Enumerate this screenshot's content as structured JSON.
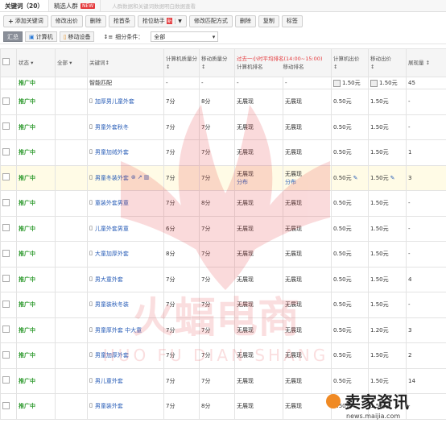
{
  "tabs": {
    "keywords": "关键词（20）",
    "crowd": "精选人群",
    "crowd_badge": "NEW",
    "note": "人群数据和关键词数据明白数据查看"
  },
  "toolbar": {
    "add": "添加关键词",
    "edit_bid": "修改出价",
    "delete_top": "删除",
    "rush": "抢首条",
    "rank": "抢位助手",
    "rank_badge": "新",
    "match": "修改匹配方式",
    "delete": "删除",
    "copy": "复制",
    "tag": "标签"
  },
  "filter": {
    "summary": "汇总",
    "pc": "计算机",
    "mobile": "移动设备",
    "cond_label": "细分条件：",
    "cond_value": "全部"
  },
  "header": {
    "status": "状态",
    "all": "全部",
    "keyword": "关键词",
    "pc_score": "计算机质量分",
    "mobile_score": "移动质量分",
    "hour_red": "过去一小时平均排名(14:00~15:00)",
    "pc_rank": "计算机排名",
    "mobile_rank": "移动排名",
    "pc_bid": "计算机出价",
    "mobile_bid": "移动出价",
    "impr": "展现量"
  },
  "rows": [
    {
      "status": "推广中",
      "keyword": "智能匹配",
      "pc_score": "-",
      "mobile_score": "-",
      "pc_rank": "-",
      "mobile_rank": "-",
      "pc_bid": "1.50元",
      "mobile_bid": "1.50元",
      "impr": "45",
      "smart": true
    },
    {
      "status": "推广中",
      "keyword": "加厚男儿童外套",
      "pc_score": "7分",
      "mobile_score": "8分",
      "pc_rank": "无展现",
      "mobile_rank": "无展现",
      "pc_bid": "0.50元",
      "mobile_bid": "1.50元",
      "impr": "-"
    },
    {
      "status": "推广中",
      "keyword": "男童外套秋冬",
      "pc_score": "7分",
      "mobile_score": "7分",
      "pc_rank": "无展现",
      "mobile_rank": "无展现",
      "pc_bid": "0.50元",
      "mobile_bid": "1.50元",
      "impr": "-"
    },
    {
      "status": "推广中",
      "keyword": "男童加绒外套",
      "pc_score": "7分",
      "mobile_score": "7分",
      "pc_rank": "无展现",
      "mobile_rank": "无展现",
      "pc_bid": "0.50元",
      "mobile_bid": "1.50元",
      "impr": "1"
    },
    {
      "status": "推广中",
      "keyword": "男童冬装外套",
      "pc_score": "7分",
      "mobile_score": "7分",
      "pc_rank": "无展现",
      "pc_rank2": "分布",
      "mobile_rank": "无展现",
      "mobile_rank2": "分布",
      "pc_bid": "0.50元",
      "mobile_bid": "1.50元",
      "impr": "3",
      "hl": true
    },
    {
      "status": "推广中",
      "keyword": "童装外套男童",
      "pc_score": "7分",
      "mobile_score": "8分",
      "pc_rank": "无展现",
      "mobile_rank": "无展现",
      "pc_bid": "0.50元",
      "mobile_bid": "1.50元",
      "impr": "-"
    },
    {
      "status": "推广中",
      "keyword": "儿童外套男童",
      "pc_score": "6分",
      "mobile_score": "7分",
      "pc_rank": "无展现",
      "mobile_rank": "无展现",
      "pc_bid": "0.50元",
      "mobile_bid": "1.50元",
      "impr": "-"
    },
    {
      "status": "推广中",
      "keyword": "大童加厚外套",
      "pc_score": "8分",
      "mobile_score": "7分",
      "pc_rank": "无展现",
      "mobile_rank": "无展现",
      "pc_bid": "0.50元",
      "mobile_bid": "1.50元",
      "impr": "-"
    },
    {
      "status": "推广中",
      "keyword": "男大童外套",
      "pc_score": "7分",
      "mobile_score": "7分",
      "pc_rank": "无展现",
      "mobile_rank": "无展现",
      "pc_bid": "0.50元",
      "mobile_bid": "1.50元",
      "impr": "4"
    },
    {
      "status": "推广中",
      "keyword": "男童装秋冬装",
      "pc_score": "7分",
      "mobile_score": "7分",
      "pc_rank": "无展现",
      "mobile_rank": "无展现",
      "pc_bid": "0.50元",
      "mobile_bid": "1.50元",
      "impr": "-"
    },
    {
      "status": "推广中",
      "keyword": "男童厚外套 中大童",
      "pc_score": "7分",
      "mobile_score": "7分",
      "pc_rank": "无展现",
      "mobile_rank": "无展现",
      "pc_bid": "0.50元",
      "mobile_bid": "1.20元",
      "impr": "3"
    },
    {
      "status": "推广中",
      "keyword": "男童加厚外套",
      "pc_score": "7分",
      "mobile_score": "7分",
      "pc_rank": "无展现",
      "mobile_rank": "无展现",
      "pc_bid": "0.50元",
      "mobile_bid": "1.50元",
      "impr": "2"
    },
    {
      "status": "推广中",
      "keyword": "男儿童外套",
      "pc_score": "7分",
      "mobile_score": "7分",
      "pc_rank": "无展现",
      "mobile_rank": "无展现",
      "pc_bid": "0.50元",
      "mobile_bid": "1.50元",
      "impr": "14"
    },
    {
      "status": "推广中",
      "keyword": "男童装外套",
      "pc_score": "7分",
      "mobile_score": "8分",
      "pc_rank": "无展现",
      "mobile_rank": "无展现",
      "pc_bid": "0.50元",
      "mobile_bid": "1.50元",
      "impr": "-"
    }
  ],
  "watermark": {
    "brand": "火蝠电商",
    "pinyin": "HUO FU DIAN SHANG",
    "site": "卖家资讯",
    "url": "news.maijia.com"
  }
}
